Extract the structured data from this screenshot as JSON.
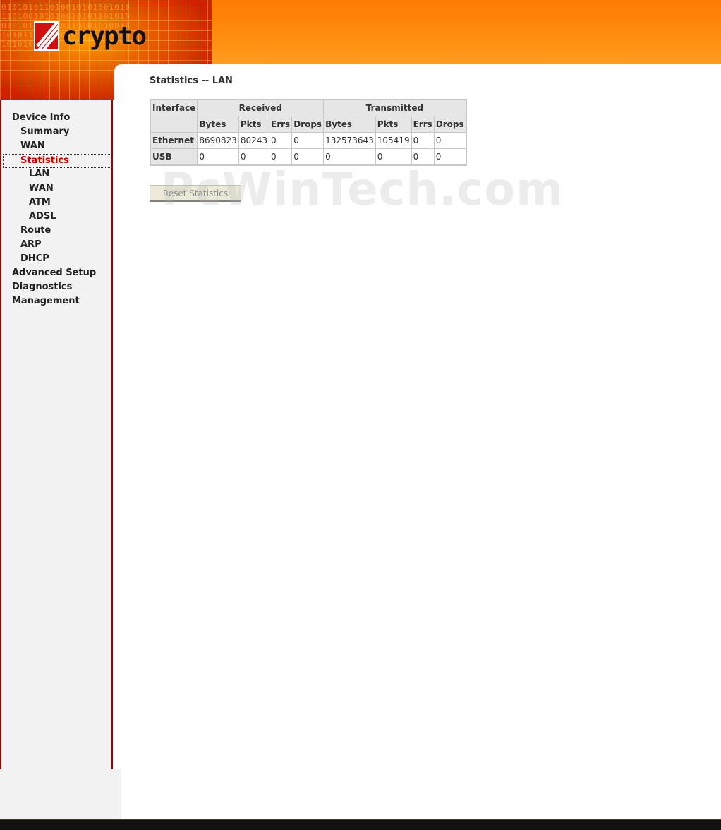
{
  "header": {
    "logo_text": "crypto",
    "binary_pattern": "01010101101001010100101011010010101001010110101001010101001011010101001010101101010010101101010010101001"
  },
  "sidebar": {
    "items": [
      {
        "label": "Device Info",
        "level": 0
      },
      {
        "label": "Summary",
        "level": 1
      },
      {
        "label": "WAN",
        "level": 1
      },
      {
        "label": "Statistics",
        "level": 1,
        "active": true
      },
      {
        "label": "LAN",
        "level": 2
      },
      {
        "label": "WAN",
        "level": 2
      },
      {
        "label": "ATM",
        "level": 2
      },
      {
        "label": "ADSL",
        "level": 2
      },
      {
        "label": "Route",
        "level": 1
      },
      {
        "label": "ARP",
        "level": 1
      },
      {
        "label": "DHCP",
        "level": 1
      },
      {
        "label": "Advanced Setup",
        "level": 0
      },
      {
        "label": "Diagnostics",
        "level": 0
      },
      {
        "label": "Management",
        "level": 0
      }
    ]
  },
  "main": {
    "title": "Statistics -- LAN",
    "table": {
      "col_interface": "Interface",
      "group_received": "Received",
      "group_transmitted": "Transmitted",
      "sub_headers": [
        "Bytes",
        "Pkts",
        "Errs",
        "Drops",
        "Bytes",
        "Pkts",
        "Errs",
        "Drops"
      ],
      "rows": [
        {
          "name": "Ethernet",
          "values": [
            "8690823",
            "80243",
            "0",
            "0",
            "132573643",
            "105419",
            "0",
            "0"
          ]
        },
        {
          "name": "USB",
          "values": [
            "0",
            "0",
            "0",
            "0",
            "0",
            "0",
            "0",
            "0"
          ]
        }
      ]
    },
    "reset_button": "Reset Statistics"
  },
  "watermark": "PcWinTech.com",
  "colors": {
    "accent": "#ff7a00",
    "active_nav": "#cc0000",
    "sidebar_border": "#a00000"
  }
}
